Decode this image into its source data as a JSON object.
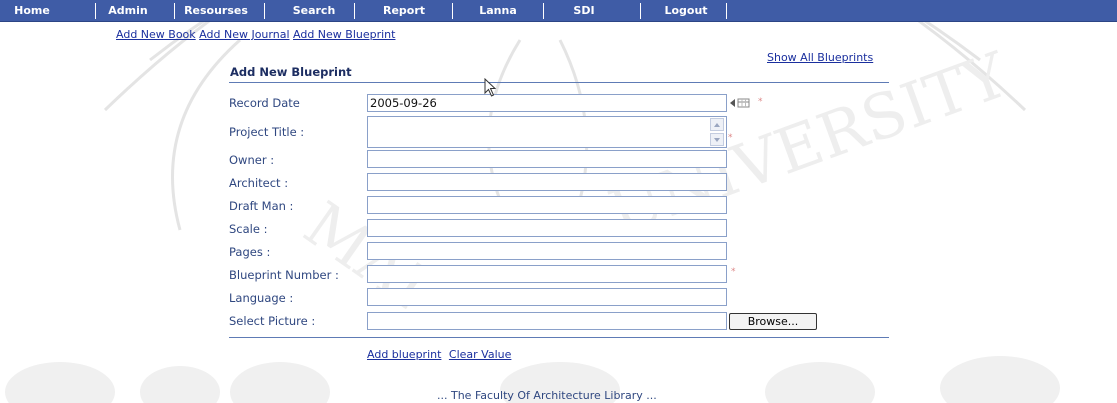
{
  "nav": {
    "items": [
      {
        "id": "home",
        "label": "Home"
      },
      {
        "id": "admin",
        "label": "Admin"
      },
      {
        "id": "resources",
        "label": "Resourses"
      },
      {
        "id": "search",
        "label": "Search"
      },
      {
        "id": "report",
        "label": "Report"
      },
      {
        "id": "lanna",
        "label": "Lanna"
      },
      {
        "id": "sdi",
        "label": "SDI"
      },
      {
        "id": "logout",
        "label": "Logout"
      }
    ]
  },
  "sublinks": {
    "add_book": "Add New Book",
    "add_journal": "Add New Journal",
    "add_blueprint": "Add New Blueprint"
  },
  "show_all": "Show All Blueprints",
  "form": {
    "title": "Add New Blueprint",
    "fields": {
      "record_date": {
        "label": "Record Date",
        "value": "2005-09-26"
      },
      "project_title": {
        "label": "Project Title :",
        "value": ""
      },
      "owner": {
        "label": "Owner :",
        "value": ""
      },
      "architect": {
        "label": "Architect :",
        "value": ""
      },
      "draft_man": {
        "label": "Draft Man :",
        "value": ""
      },
      "scale": {
        "label": "Scale :",
        "value": ""
      },
      "pages": {
        "label": "Pages :",
        "value": ""
      },
      "blueprint_number": {
        "label": "Blueprint Number :",
        "value": ""
      },
      "language": {
        "label": "Language :",
        "value": ""
      },
      "select_picture": {
        "label": "Select Picture :",
        "value": ""
      }
    },
    "browse_label": "Browse...",
    "required_marker": "*",
    "add_label": "Add blueprint",
    "clear_label": "Clear Value"
  },
  "footer": "... The Faculty Of Architecture Library ...",
  "colors": {
    "nav_bg": "#3f5ca6",
    "link": "#1a2f9e",
    "label": "#2f4780",
    "watermark": "#e6e6e6"
  }
}
